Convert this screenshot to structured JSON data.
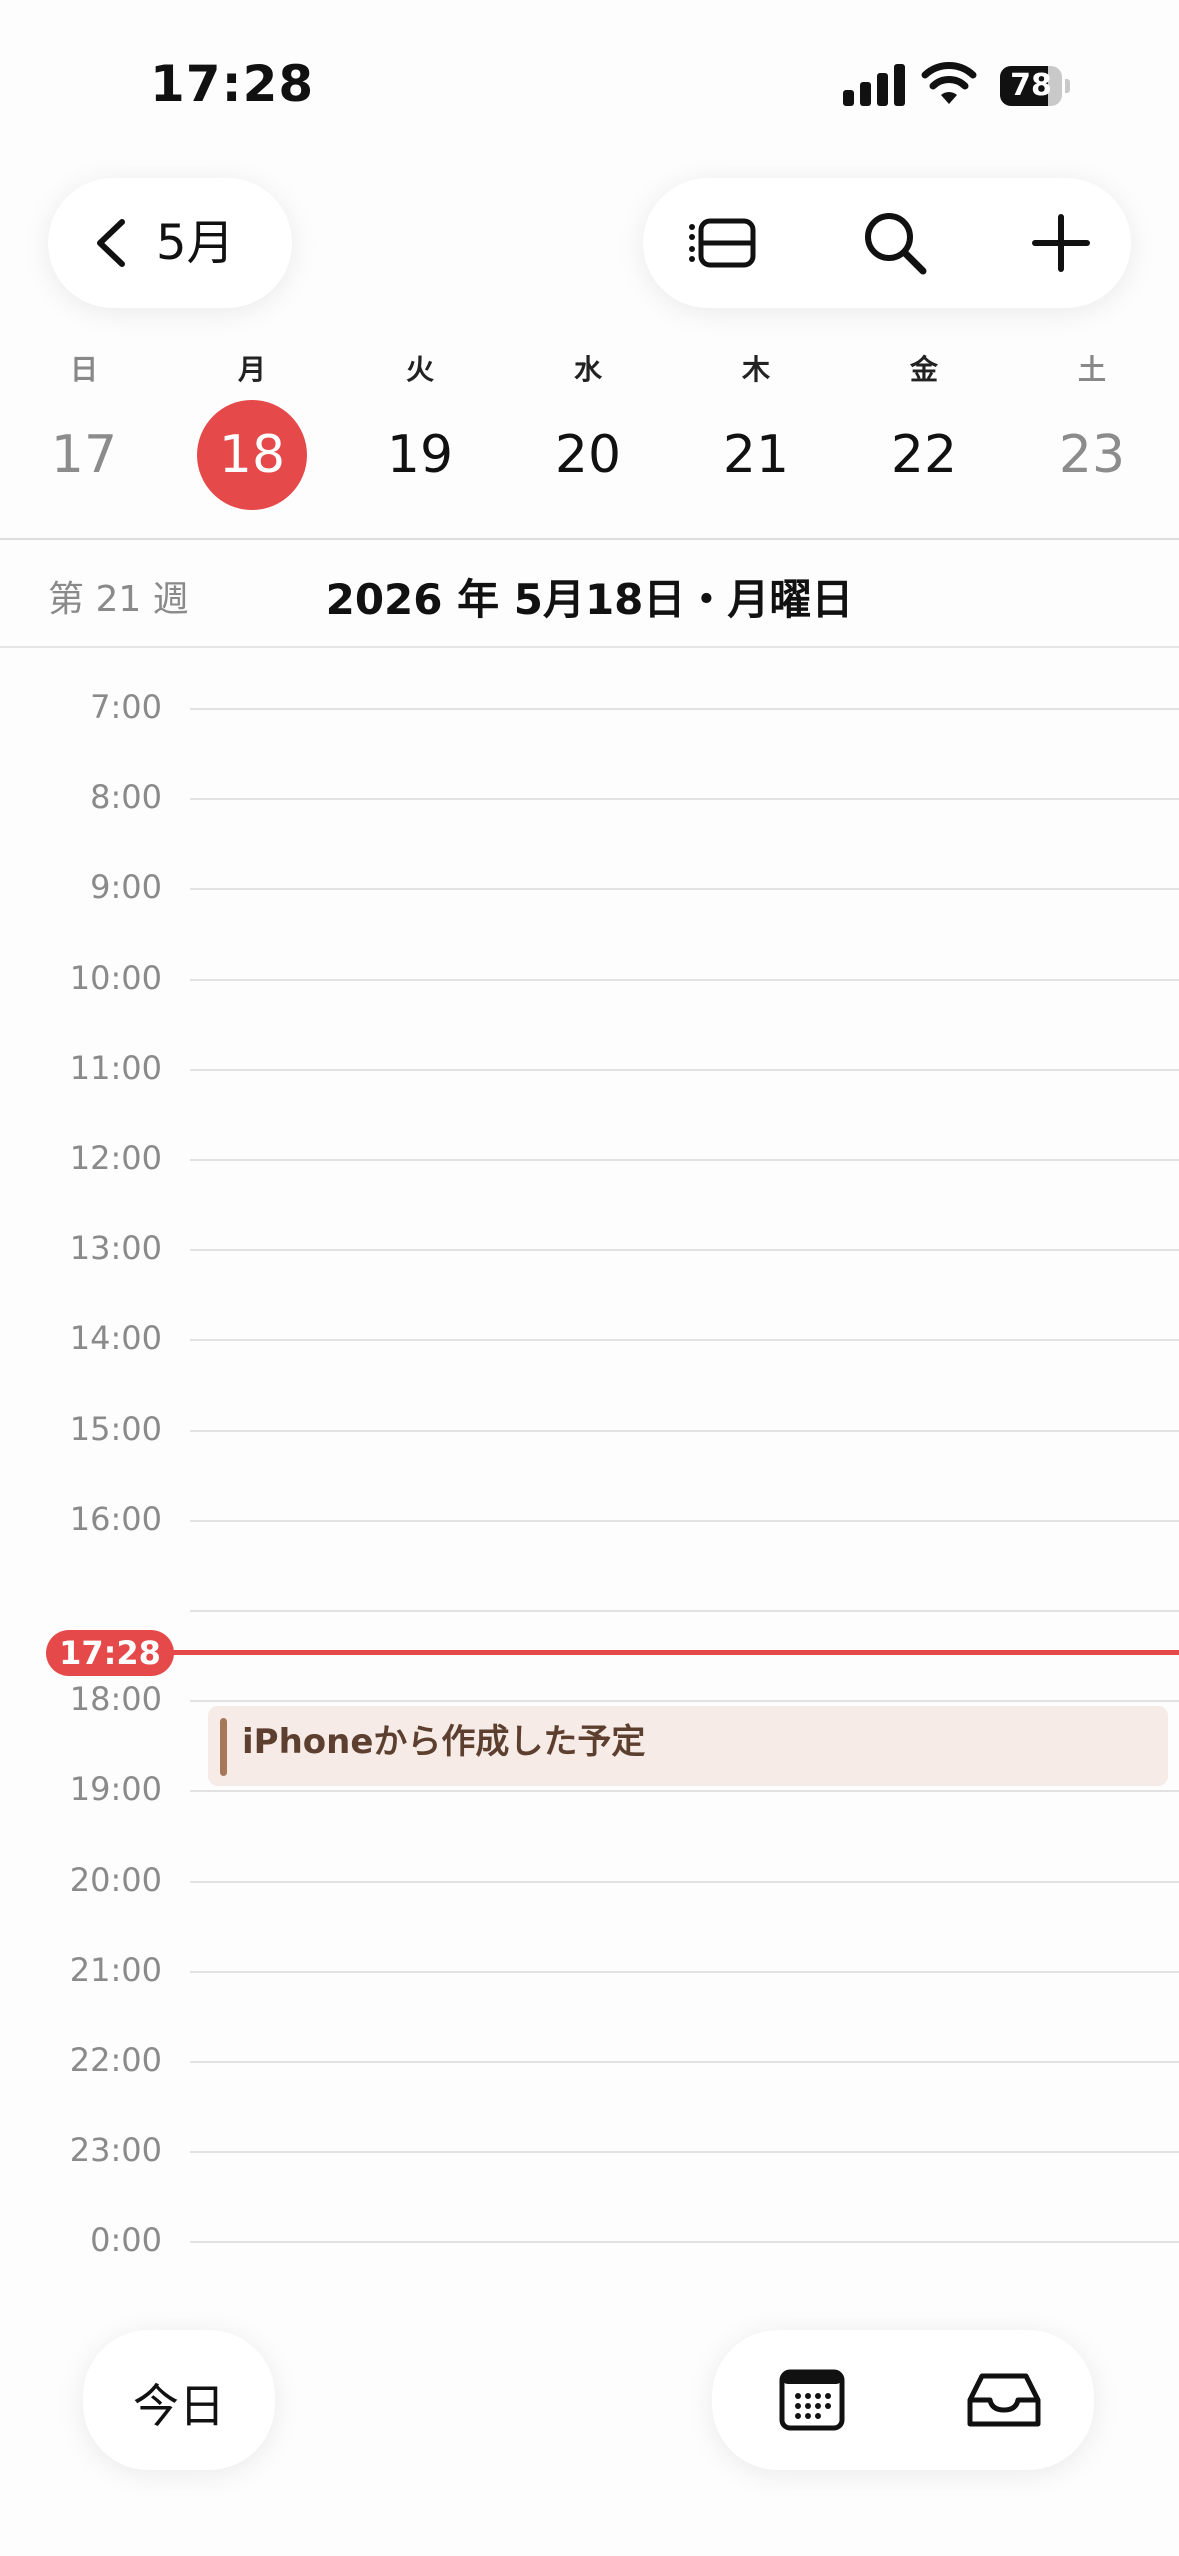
{
  "status_bar": {
    "time": "17:28",
    "battery": "78",
    "battery_level": 0.78
  },
  "header": {
    "month": "5月"
  },
  "week": {
    "days": [
      {
        "dow": "日",
        "day": "17"
      },
      {
        "dow": "月",
        "day": "18"
      },
      {
        "dow": "火",
        "day": "19"
      },
      {
        "dow": "水",
        "day": "20"
      },
      {
        "dow": "木",
        "day": "21"
      },
      {
        "dow": "金",
        "day": "22"
      },
      {
        "dow": "土",
        "day": "23"
      }
    ]
  },
  "date_bar": {
    "week_number": "第 21 週",
    "title": "2026 年 5月18日・月曜日"
  },
  "timeline": {
    "hours": [
      "7:00",
      "8:00",
      "9:00",
      "10:00",
      "11:00",
      "12:00",
      "13:00",
      "14:00",
      "15:00",
      "16:00",
      "",
      "18:00",
      "19:00",
      "20:00",
      "21:00",
      "22:00",
      "23:00",
      "0:00"
    ],
    "now": "17:28"
  },
  "event": {
    "title": "iPhoneから作成した予定"
  },
  "bottom_bar": {
    "today": "今日"
  },
  "colors": {
    "accent": "#e5494a",
    "event_bg": "#f6ebe6",
    "event_bar": "#a67759"
  }
}
